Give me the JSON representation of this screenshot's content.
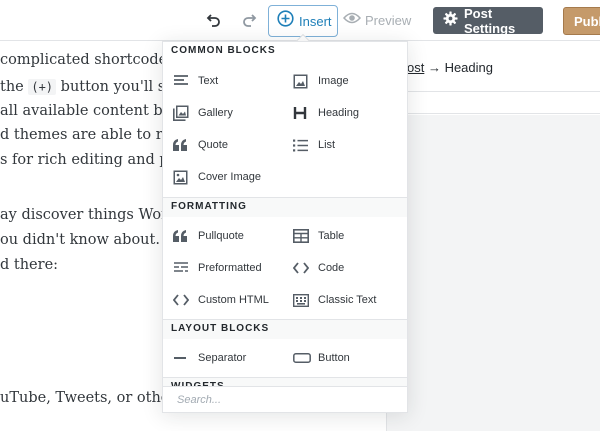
{
  "toolbar": {
    "undo_icon": "undo-icon",
    "redo_icon": "redo-icon",
    "insert_label": "Insert",
    "preview_label": "Preview",
    "post_settings_label": "Post Settings",
    "publish_label": "Publi"
  },
  "content": {
    "lines": [
      "complicated shortcode s",
      "the",
      "button you'll see",
      "all available content blo",
      "d themes are able to regi",
      "s for rich editing and pub",
      "ay discover things Word",
      "ou didn't know about. He",
      "d there:",
      "uTube, Tweets, or other W"
    ],
    "inline_code": "(+)"
  },
  "sidebar": {
    "breadcrumb_link": "ost",
    "breadcrumb_rest": " → Heading"
  },
  "inserter": {
    "categories": [
      "COMMON BLOCKS",
      "FORMATTING",
      "LAYOUT BLOCKS",
      "WIDGETS"
    ],
    "common": [
      {
        "label": "Text",
        "icon": "text-icon"
      },
      {
        "label": "Image",
        "icon": "image-icon"
      },
      {
        "label": "Gallery",
        "icon": "gallery-icon"
      },
      {
        "label": "Heading",
        "icon": "heading-icon"
      },
      {
        "label": "Quote",
        "icon": "quote-icon"
      },
      {
        "label": "List",
        "icon": "list-icon"
      },
      {
        "label": "Cover Image",
        "icon": "cover-image-icon"
      }
    ],
    "formatting": [
      {
        "label": "Pullquote",
        "icon": "pullquote-icon"
      },
      {
        "label": "Table",
        "icon": "table-icon"
      },
      {
        "label": "Preformatted",
        "icon": "preformatted-icon"
      },
      {
        "label": "Code",
        "icon": "code-icon"
      },
      {
        "label": "Custom HTML",
        "icon": "custom-html-icon"
      },
      {
        "label": "Classic Text",
        "icon": "classic-text-icon"
      }
    ],
    "layout": [
      {
        "label": "Separator",
        "icon": "separator-icon"
      },
      {
        "label": "Button",
        "icon": "button-icon"
      }
    ],
    "search_placeholder": "Search..."
  },
  "colors": {
    "accent": "#1e7fb8",
    "post_settings_bg": "#555d66",
    "publish_bg": "#c59a6a"
  }
}
